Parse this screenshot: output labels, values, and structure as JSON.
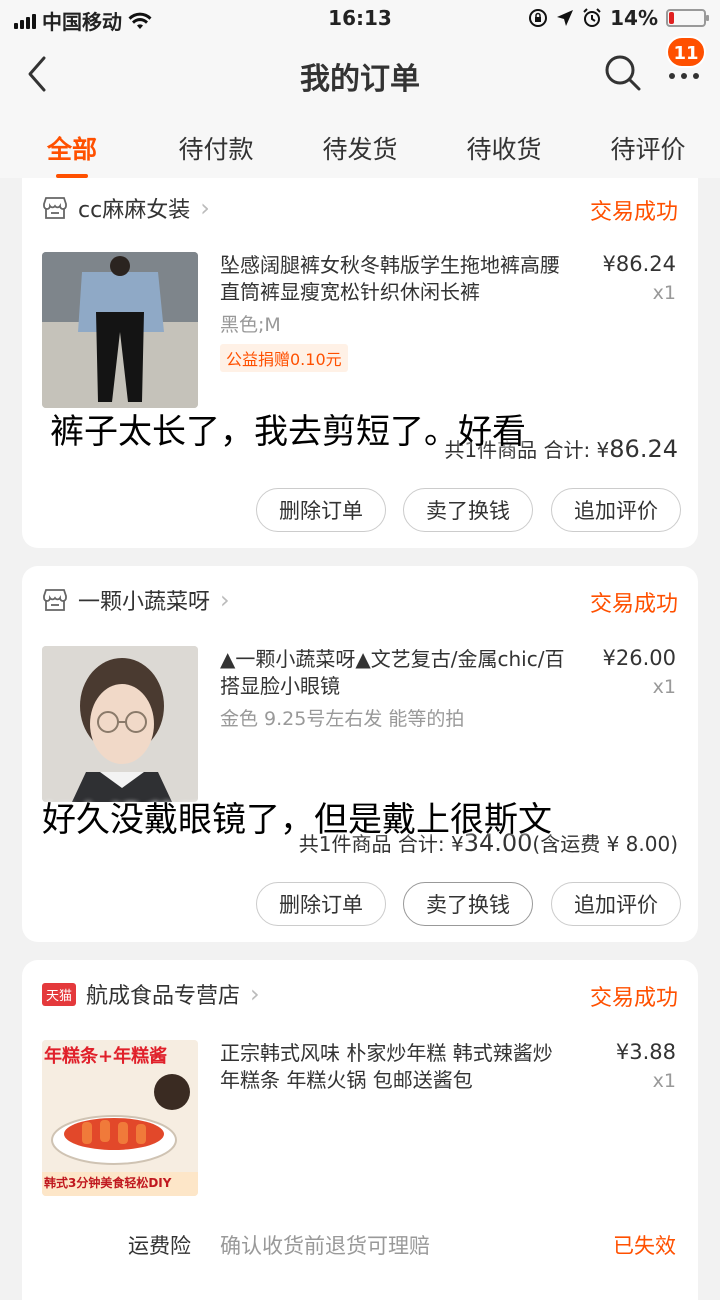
{
  "status_bar": {
    "carrier": "中国移动",
    "time": "16:13",
    "battery": "14%",
    "battery_level": 0.14
  },
  "header": {
    "title": "我的订单",
    "badge": "11"
  },
  "tabs": [
    "全部",
    "待付款",
    "待发货",
    "待收货",
    "待评价"
  ],
  "orders": [
    {
      "shop": "cc麻麻女装",
      "status": "交易成功",
      "product_title": "坠感阔腿裤女秋冬韩版学生拖地裤高腰直筒裤显瘦宽松针织休闲长裤",
      "attr": "黑色;M",
      "charity": "公益捐赠0.10元",
      "price": "¥86.24",
      "qty": "x1",
      "total_prefix": "共1件商品 合计: ¥",
      "total_amount": "86.24",
      "total_suffix": "",
      "buttons": [
        "删除订单",
        "卖了换钱",
        "追加评价"
      ],
      "overlay_text": "裤子太长了，我去剪短了。好看"
    },
    {
      "shop": "一颗小蔬菜呀",
      "status": "交易成功",
      "product_title": "▲一颗小蔬菜呀▲文艺复古/金属chic/百搭显脸小眼镜",
      "attr": "金色 9.25号左右发 能等的拍",
      "price": "¥26.00",
      "qty": "x1",
      "total_prefix": "共1件商品 合计: ¥",
      "total_amount": "34.00",
      "total_suffix": "(含运费 ¥ 8.00)",
      "buttons": [
        "删除订单",
        "卖了换钱",
        "追加评价"
      ],
      "overlay_text": "好久没戴眼镜了，但是戴上很斯文"
    },
    {
      "shop": "航成食品专营店",
      "shop_badge": "天猫",
      "status": "交易成功",
      "product_title": "正宗韩式风味 朴家炒年糕 韩式辣酱炒年糕条 年糕火锅 包邮送酱包",
      "price": "¥3.88",
      "qty": "x1",
      "thumb_text_top": "年糕条+年糕酱",
      "thumb_text_bottom": "韩式3分钟美食轻松DIY",
      "shipping_insurance_label": "运费险",
      "shipping_insurance_desc": "确认收货前退货可理赔",
      "shipping_insurance_status": "已失效"
    }
  ]
}
